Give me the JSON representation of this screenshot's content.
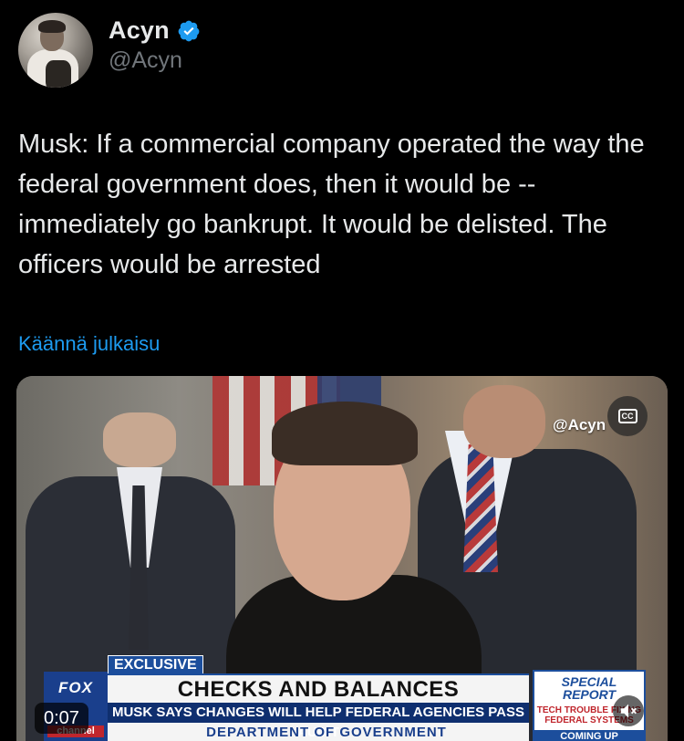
{
  "author": {
    "display_name": "Acyn",
    "handle": "@Acyn",
    "verified_icon": "verified-badge-icon"
  },
  "tweet": {
    "text": "Musk: If a commercial company operated the way the federal government does, then it would be -- immediately go bankrupt. It would be delisted. The officers would be arrested",
    "translate_label": "Käännä julkaisu"
  },
  "video": {
    "watermark": "@Acyn",
    "cc_label": "CC",
    "time": "0:07",
    "mute_icon": "speaker-muted-icon",
    "chyron": {
      "tag": "EXCLUSIVE",
      "headline": "CHECKS AND BALANCES",
      "subline": "MUSK SAYS CHANGES WILL HELP FEDERAL AGENCIES PASS AUDIT",
      "footer": "DEPARTMENT OF GOVERNMENT EFFICIENCY",
      "network_logo": "FOX",
      "network_channel": "channel",
      "side_title": "SPECIAL REPORT",
      "side_tease": "TECH TROUBLE FIXING FEDERAL SYSTEMS",
      "side_coming": "COMING UP"
    }
  },
  "colors": {
    "background": "#000000",
    "text": "#e7e9ea",
    "secondary": "#71767b",
    "link": "#1d9bf0",
    "verified": "#1d9bf0"
  }
}
